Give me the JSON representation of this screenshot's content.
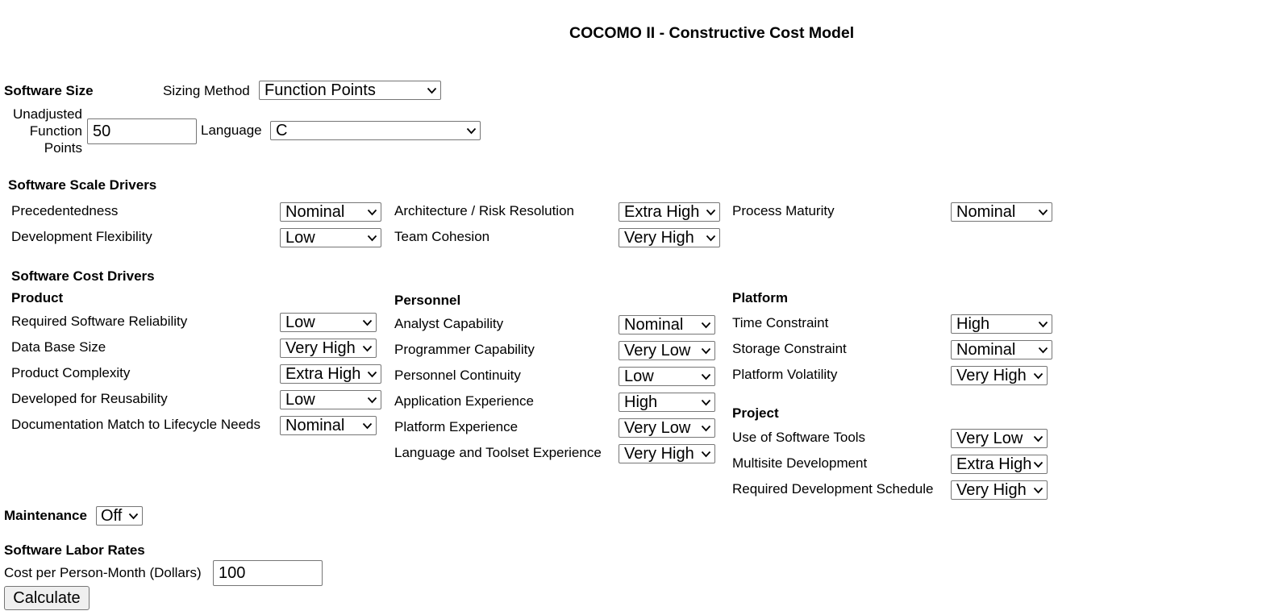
{
  "page": {
    "title": "COCOMO II - Constructive Cost Model"
  },
  "size": {
    "heading": "Software Size",
    "sizing_method_label": "Sizing Method",
    "sizing_method_value": "Function Points",
    "ufp_label_line1": "Unadjusted",
    "ufp_label_line2": "Function",
    "ufp_label_line3": "Points",
    "ufp_value": "50",
    "language_label": "Language",
    "language_value": "C"
  },
  "scale": {
    "heading": "Software Scale Drivers",
    "precedentedness": {
      "label": "Precedentedness",
      "value": "Nominal"
    },
    "flexibility": {
      "label": "Development Flexibility",
      "value": "Low"
    },
    "architecture": {
      "label": "Architecture / Risk Resolution",
      "value": "Extra High"
    },
    "cohesion": {
      "label": "Team Cohesion",
      "value": "Very High"
    },
    "maturity": {
      "label": "Process Maturity",
      "value": "Nominal"
    }
  },
  "cost": {
    "heading": "Software Cost Drivers",
    "product": {
      "heading": "Product",
      "reliability": {
        "label": "Required Software Reliability",
        "value": "Low"
      },
      "database": {
        "label": "Data Base Size",
        "value": "Very High"
      },
      "complexity": {
        "label": "Product Complexity",
        "value": "Extra High"
      },
      "reusability": {
        "label": "Developed for Reusability",
        "value": "Low"
      },
      "documentation": {
        "label": "Documentation Match to Lifecycle Needs",
        "value": "Nominal"
      }
    },
    "personnel": {
      "heading": "Personnel",
      "analyst": {
        "label": "Analyst Capability",
        "value": "Nominal"
      },
      "programmer": {
        "label": "Programmer Capability",
        "value": "Very Low"
      },
      "continuity": {
        "label": "Personnel Continuity",
        "value": "Low"
      },
      "application": {
        "label": "Application Experience",
        "value": "High"
      },
      "platform_exp": {
        "label": "Platform Experience",
        "value": "Very Low"
      },
      "language_exp": {
        "label": "Language and Toolset Experience",
        "value": "Very High"
      }
    },
    "platform": {
      "heading": "Platform",
      "time": {
        "label": "Time Constraint",
        "value": "High"
      },
      "storage": {
        "label": "Storage Constraint",
        "value": "Nominal"
      },
      "volatility": {
        "label": "Platform Volatility",
        "value": "Very High"
      }
    },
    "project": {
      "heading": "Project",
      "tools": {
        "label": "Use of Software Tools",
        "value": "Very Low"
      },
      "multisite": {
        "label": "Multisite Development",
        "value": "Extra High"
      },
      "schedule": {
        "label": "Required Development Schedule",
        "value": "Very High"
      }
    }
  },
  "maintenance": {
    "label": "Maintenance",
    "value": "Off"
  },
  "labor": {
    "heading": "Software Labor Rates",
    "cost_label": "Cost per Person-Month (Dollars)",
    "cost_value": "100"
  },
  "calculate_label": "Calculate",
  "icons": {
    "dropdown": "chevron-down-icon"
  }
}
